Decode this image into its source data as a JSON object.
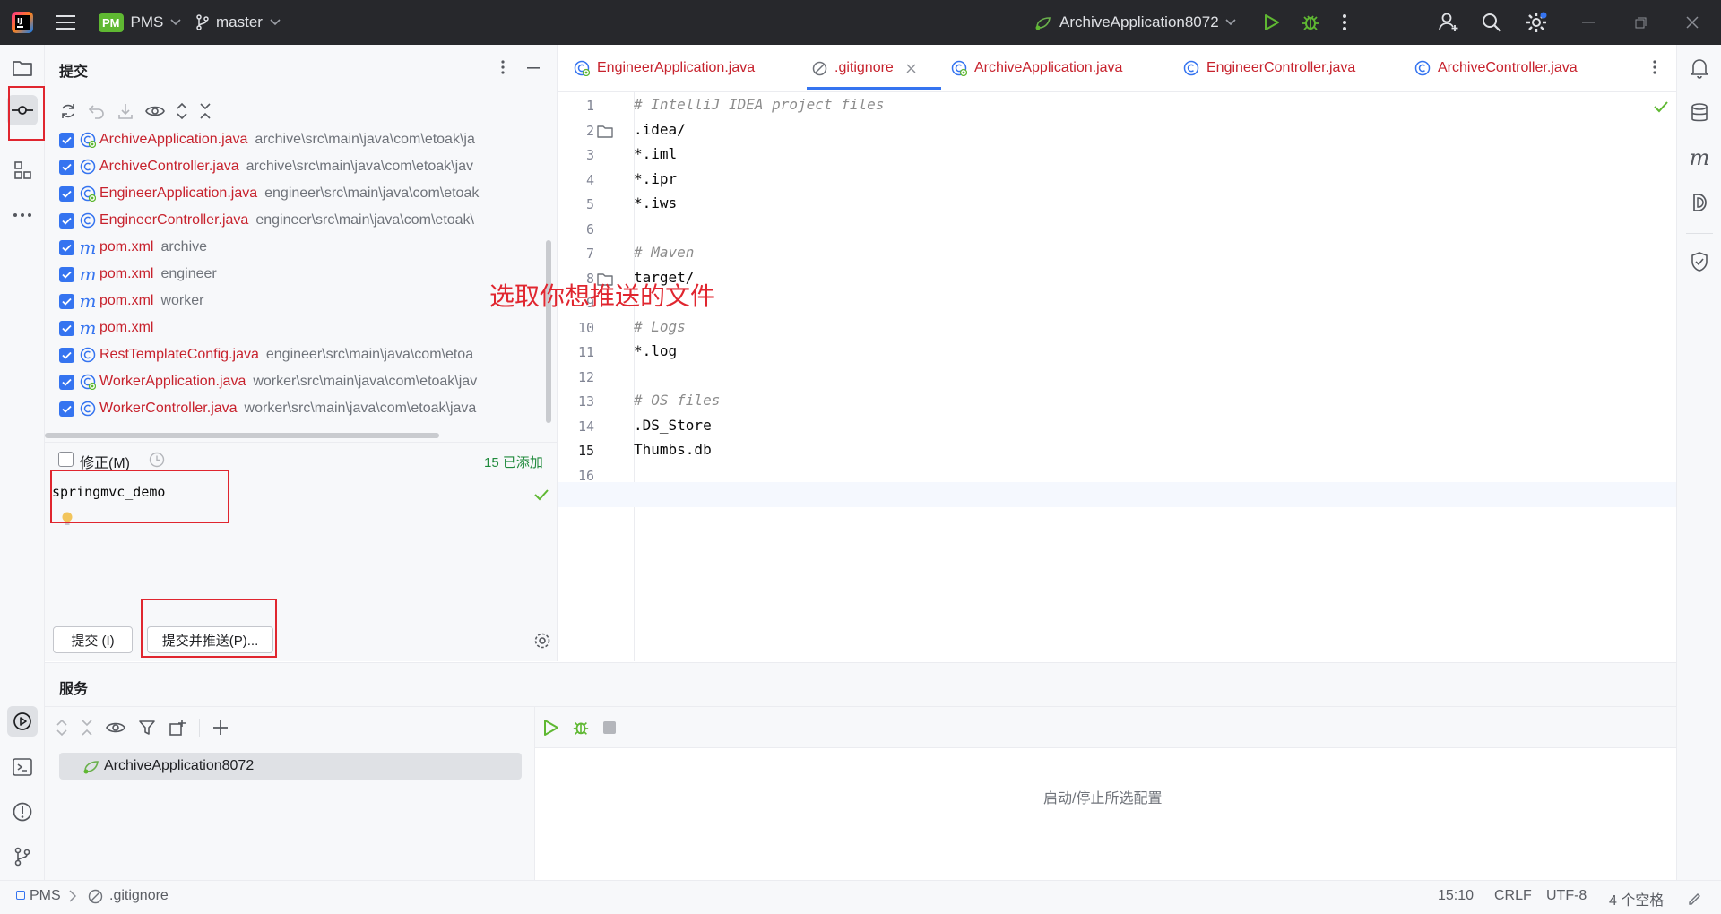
{
  "titlebar": {
    "project_badge": "PM",
    "project_name": "PMS",
    "branch": "master",
    "run_config": "ArchiveApplication8072"
  },
  "commit_panel": {
    "title": "提交",
    "files": [
      {
        "name": "ArchiveApplication.java",
        "path": "archive\\src\\main\\java\\com\\etoak\\ja",
        "icon": "spring-class-icon"
      },
      {
        "name": "ArchiveController.java",
        "path": "archive\\src\\main\\java\\com\\etoak\\jav",
        "icon": "class-icon"
      },
      {
        "name": "EngineerApplication.java",
        "path": "engineer\\src\\main\\java\\com\\etoak",
        "icon": "spring-class-icon"
      },
      {
        "name": "EngineerController.java",
        "path": "engineer\\src\\main\\java\\com\\etoak\\",
        "icon": "class-icon"
      },
      {
        "name": "pom.xml",
        "path": "archive",
        "icon": "maven-icon"
      },
      {
        "name": "pom.xml",
        "path": "engineer",
        "icon": "maven-icon"
      },
      {
        "name": "pom.xml",
        "path": "worker",
        "icon": "maven-icon"
      },
      {
        "name": "pom.xml",
        "path": "",
        "icon": "maven-icon"
      },
      {
        "name": "RestTemplateConfig.java",
        "path": "engineer\\src\\main\\java\\com\\etoa",
        "icon": "class-icon"
      },
      {
        "name": "WorkerApplication.java",
        "path": "worker\\src\\main\\java\\com\\etoak\\jav",
        "icon": "spring-class-icon"
      },
      {
        "name": "WorkerController.java",
        "path": "worker\\src\\main\\java\\com\\etoak\\java",
        "icon": "class-icon"
      }
    ],
    "amend_label": "修正(M)",
    "added_count": "15 已添加",
    "commit_message": "springmvc_demo",
    "commit_button": "提交 (I)",
    "commit_push_button": "提交并推送(P)..."
  },
  "annotation": "选取你想推送的文件",
  "editor": {
    "tabs": [
      {
        "label": "EngineerApplication.java",
        "icon": "spring-class-icon"
      },
      {
        "label": ".gitignore",
        "icon": "ignore-icon",
        "active": true
      },
      {
        "label": "ArchiveApplication.java",
        "icon": "spring-class-icon"
      },
      {
        "label": "EngineerController.java",
        "icon": "class-icon"
      },
      {
        "label": "ArchiveController.java",
        "icon": "class-icon"
      }
    ],
    "lines": [
      {
        "n": "1",
        "t": "# IntelliJ IDEA project files",
        "cmt": true
      },
      {
        "n": "2",
        "t": ".idea/",
        "folder": true
      },
      {
        "n": "3",
        "t": "*.iml"
      },
      {
        "n": "4",
        "t": "*.ipr"
      },
      {
        "n": "5",
        "t": "*.iws"
      },
      {
        "n": "6",
        "t": ""
      },
      {
        "n": "7",
        "t": "# Maven",
        "cmt": true
      },
      {
        "n": "8",
        "t": "target/",
        "folder": true
      },
      {
        "n": "9",
        "t": ""
      },
      {
        "n": "10",
        "t": "# Logs",
        "cmt": true
      },
      {
        "n": "11",
        "t": "*.log"
      },
      {
        "n": "12",
        "t": ""
      },
      {
        "n": "13",
        "t": "# OS files",
        "cmt": true
      },
      {
        "n": "14",
        "t": ".DS_Store"
      },
      {
        "n": "15",
        "t": "Thumbs.db"
      },
      {
        "n": "16",
        "t": ""
      }
    ]
  },
  "services": {
    "title": "服务",
    "item": "ArchiveApplication8072",
    "hint": "启动/停止所选配置"
  },
  "statusbar": {
    "project": "PMS",
    "file": ".gitignore",
    "position": "15:10",
    "line_sep": "CRLF",
    "encoding": "UTF-8",
    "indent": "4 个空格"
  },
  "colors": {
    "accent": "#3574f0",
    "modified_file": "#c7222d",
    "annotation_red": "#e0262f",
    "run_green": "#5fb832"
  }
}
